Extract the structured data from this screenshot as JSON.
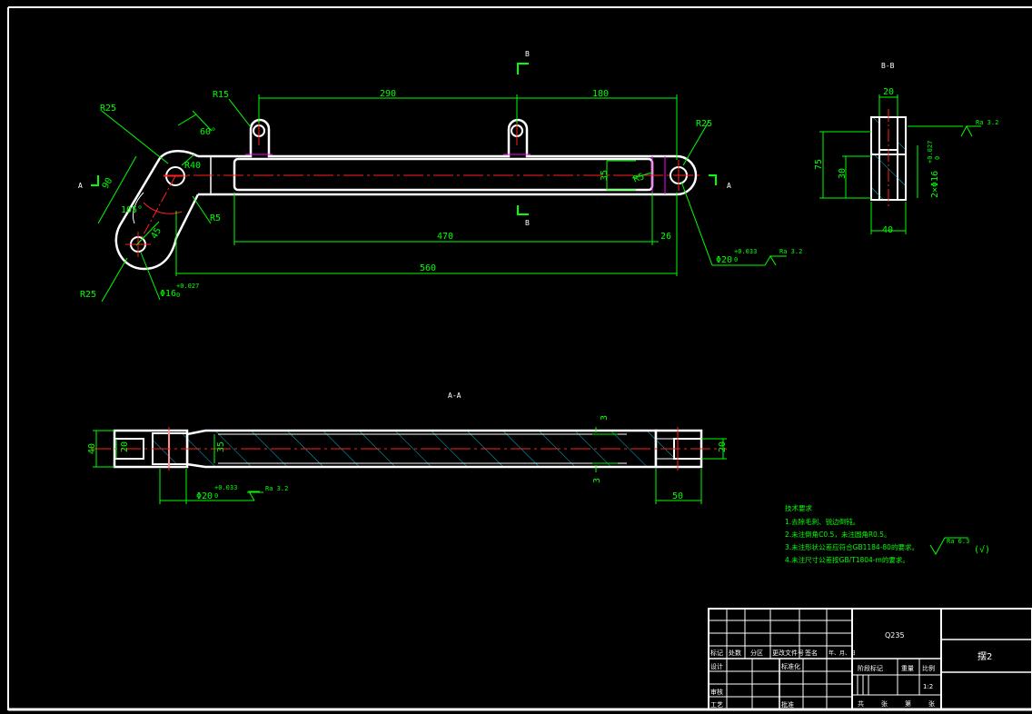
{
  "section_marks": {
    "b_top": "B",
    "b_bottom": "B",
    "a_left": "A",
    "a_right": "A",
    "view_bb": "B-B",
    "view_aa": "A-A"
  },
  "front_view": {
    "dim_290": "290",
    "dim_180": "180",
    "dim_r15": "R15",
    "dim_r25_top_left": "R25",
    "dim_60deg": "60°",
    "dim_r40": "R40",
    "dim_90": "90",
    "dim_105deg": "105°",
    "dim_45": "45",
    "dim_r5_left": "R5",
    "dim_r25_right": "R25",
    "dim_35": "35",
    "dim_r5_right": "R5",
    "dim_470": "470",
    "dim_26": "26",
    "dim_560": "560",
    "dim_r25_bottom": "R25",
    "dia16": "Φ16",
    "dia16_tol": "+0.027",
    "dia16_tol_low": "0",
    "dia20": "Φ20",
    "dia20_tol": "+0.033",
    "dia20_tol_low": "0",
    "rough_right": "Ra 3.2"
  },
  "section_bb": {
    "dim_20": "20",
    "dim_75": "75",
    "dim_30": "30",
    "dim_40": "40",
    "dia16x2": "2×Φ16",
    "dia16_tol": "+0.027",
    "dia16_tol_low": "0",
    "rough": "Ra 3.2"
  },
  "section_aa": {
    "dim_40": "40",
    "dim_20_left": "20",
    "dim_35": "35",
    "dim_3_top": "3",
    "dim_3_bottom": "3",
    "dim_20_right": "20",
    "dim_50": "50",
    "dia20": "Φ20",
    "dia20_tol": "+0.033",
    "dia20_tol_low": "0",
    "rough": "Ra 3.2"
  },
  "tech_notes": {
    "title": "技术要求",
    "lines": [
      "1.去除毛刺、锐边倒钝。",
      "2.未注倒角C0.5，未注圆角R0.5。",
      "3.未注形状公差应符合GB1184-80的要求。",
      "4.未注尺寸公差按GB/T1804-m的要求。"
    ],
    "rough_general": "Ra 6.3",
    "rough_bracket": "(√)"
  },
  "title_block": {
    "material": "Q235",
    "part_name": "摆2",
    "row_labels": [
      "标记",
      "处数",
      "分区",
      "更改文件号",
      "签名",
      "年、月、日"
    ],
    "designer": "设计",
    "standardization": "标准化",
    "reviewer": "审核",
    "process": "工艺",
    "approval": "批准",
    "stage_mark": "阶段标记",
    "weight": "重量",
    "scale_label": "比例",
    "scale": "1:2",
    "sheets": [
      "共",
      "张",
      "第",
      "张"
    ]
  }
}
